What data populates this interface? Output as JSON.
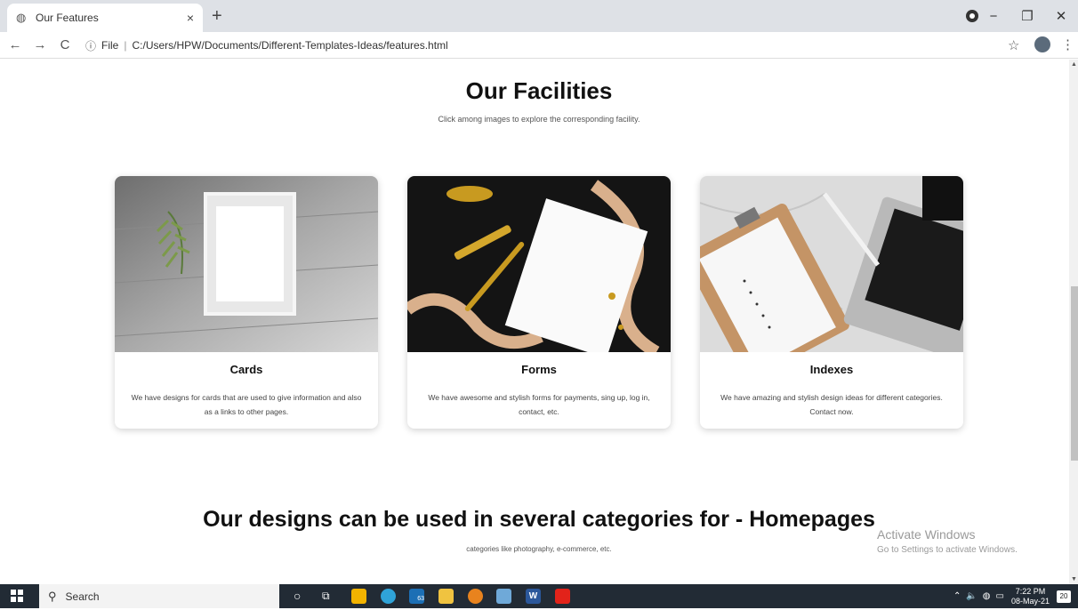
{
  "browser": {
    "tab_title": "Our Features",
    "tab_close": "×",
    "new_tab": "+",
    "url_prefix": "File",
    "url": "C:/Users/HPW/Documents/Different-Templates-Ideas/features.html",
    "back": "←",
    "forward": "→",
    "reload": "C",
    "info": "ⓘ",
    "bookmark": "☆",
    "menu": "⋮",
    "minimize": "−",
    "maximize": "❐",
    "close": "✕"
  },
  "facilities": {
    "heading": "Our Facilities",
    "subheading": "Click among images to explore the corresponding facility."
  },
  "cards": [
    {
      "title": "Cards",
      "desc": "We have designs for cards that are used to give information and also as a links to other pages."
    },
    {
      "title": "Forms",
      "desc": "We have awesome and stylish forms for payments, sing up, log in, contact, etc."
    },
    {
      "title": "Indexes",
      "desc": "We have amazing and stylish design ideas for different categories. Contact now."
    }
  ],
  "categories": {
    "heading": "Our designs can be used in several categories for - Homepages",
    "subheading": "categories like photography, e-commerce, etc."
  },
  "watermark": {
    "line1": "Activate Windows",
    "line2": "Go to Settings to activate Windows."
  },
  "taskbar": {
    "search_placeholder": "Search",
    "time": "7:22 PM",
    "date": "08-May-21",
    "notifications": "20",
    "mail_badge": "63"
  },
  "colors": {
    "tabbar": "#dee1e6",
    "taskbar": "#222b35",
    "accent_edge": "#0078d7",
    "word_blue": "#2b579a",
    "acrobat_red": "#e2231a"
  }
}
